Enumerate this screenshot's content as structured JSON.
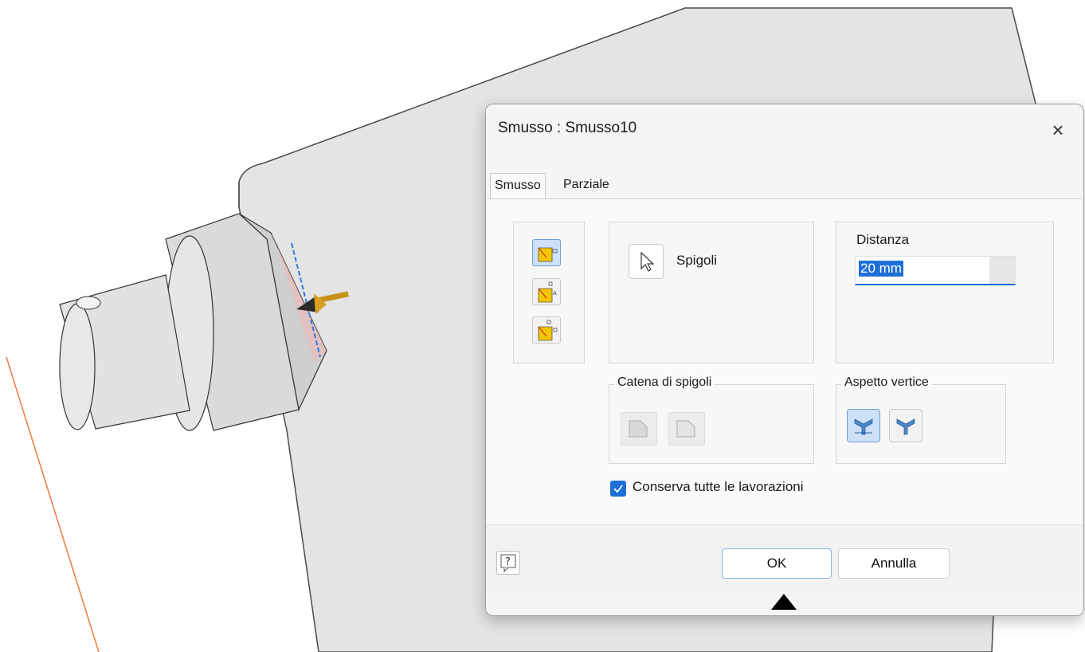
{
  "dialog": {
    "title": "Smusso : Smusso10",
    "close_icon": "×",
    "tabs": [
      {
        "label": "Smusso",
        "active": true
      },
      {
        "label": "Parziale",
        "active": false
      }
    ],
    "edges_label": "Spigoli",
    "distance": {
      "label": "Distanza",
      "value": "20 mm"
    },
    "chain_label": "Catena di spigoli",
    "corner_label": "Aspetto vertice",
    "preserve_checkbox": {
      "label": "Conserva tutte le lavorazioni",
      "checked": true
    },
    "ok_label": "OK",
    "cancel_label": "Annulla",
    "help_glyph": "?"
  },
  "colors": {
    "accent": "#1e6fd6",
    "selected_bg": "#cce0f7",
    "model_surface": "#e3e3e3",
    "sketch_line": "#f07a3a",
    "edge_highlight": "#2f7bdc"
  },
  "icons": [
    "close-icon",
    "distance-mode-icon",
    "distance-angle-mode-icon",
    "two-distances-mode-icon",
    "cursor-select-icon",
    "chain-edges-icon",
    "single-edge-icon",
    "corner-setback-icon",
    "corner-no-setback-icon",
    "help-icon",
    "expand-arrow-icon",
    "direction-arrow-icon",
    "checkmark-icon"
  ]
}
